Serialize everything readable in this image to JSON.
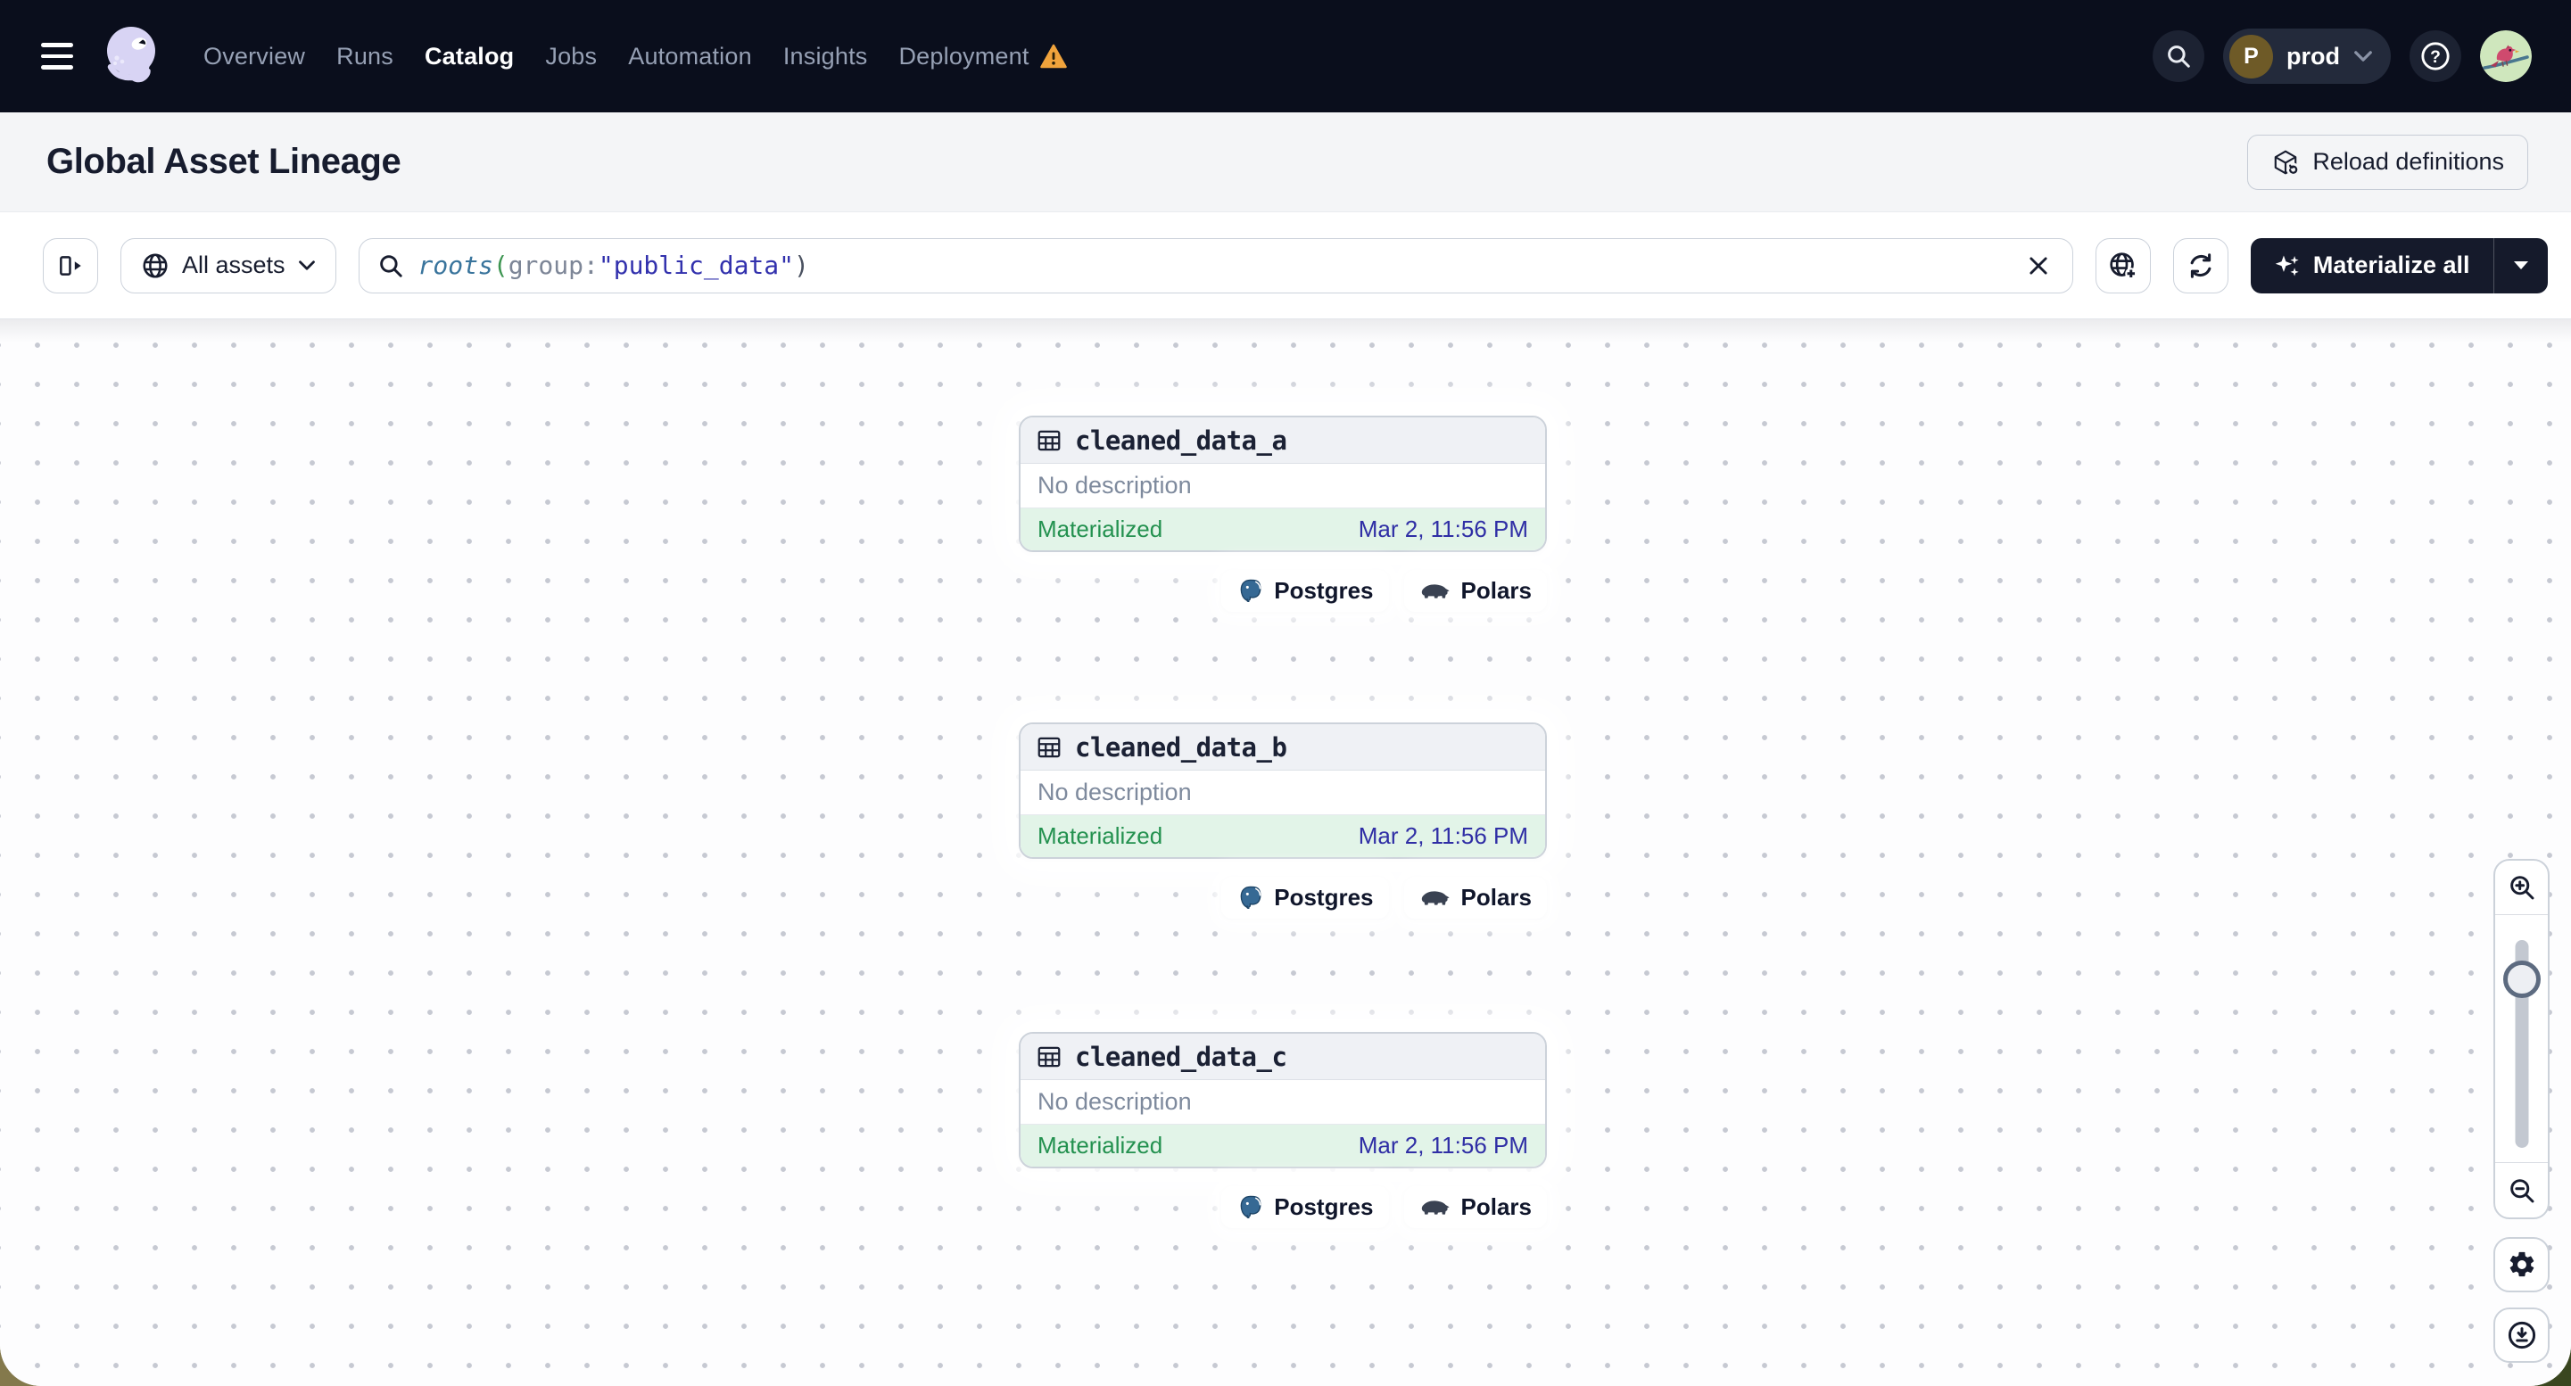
{
  "navbar": {
    "links": [
      {
        "label": "Overview",
        "active": false
      },
      {
        "label": "Runs",
        "active": false
      },
      {
        "label": "Catalog",
        "active": true
      },
      {
        "label": "Jobs",
        "active": false
      },
      {
        "label": "Automation",
        "active": false
      },
      {
        "label": "Insights",
        "active": false
      },
      {
        "label": "Deployment",
        "active": false,
        "warning": true
      }
    ],
    "environment": {
      "initial": "P",
      "name": "prod"
    },
    "icons": {
      "menu": "hamburger-menu-icon",
      "logo": "dagster-logo",
      "deployment_warning": "warning-triangle-icon",
      "search": "search-icon",
      "help": "help-icon",
      "avatar": "user-avatar"
    }
  },
  "page_header": {
    "title": "Global Asset Lineage",
    "reload_button_label": "Reload definitions",
    "reload_icon": "reload-code-location-icon"
  },
  "toolbar": {
    "panel_icon": "expand-panel-icon",
    "asset_filter_label": "All assets",
    "asset_filter_icon": "globe-icon",
    "query": {
      "full": "roots(group:\"public_data\")",
      "tokens": [
        {
          "text": "roots",
          "type": "function"
        },
        {
          "text": "(",
          "type": "paren-open"
        },
        {
          "text": "group",
          "type": "attribute"
        },
        {
          "text": ":",
          "type": "colon"
        },
        {
          "text": "\"public_data\"",
          "type": "string"
        },
        {
          "text": ")",
          "type": "paren-close"
        }
      ]
    },
    "clear_icon": "clear-x-icon",
    "graph_filter_icon": "globe-add-icon",
    "refresh_icon": "refresh-icon",
    "materialize_button_label": "Materialize all",
    "materialize_icon": "sparkles-icon"
  },
  "lineage": {
    "nodes": [
      {
        "name": "cleaned_data_a",
        "description": "No description",
        "status": "Materialized",
        "materialized_at": "Mar 2, 11:56 PM",
        "icon": "table-icon",
        "tags": [
          {
            "label": "Postgres",
            "icon": "postgres-icon"
          },
          {
            "label": "Polars",
            "icon": "polars-icon"
          }
        ]
      },
      {
        "name": "cleaned_data_b",
        "description": "No description",
        "status": "Materialized",
        "materialized_at": "Mar 2, 11:56 PM",
        "icon": "table-icon",
        "tags": [
          {
            "label": "Postgres",
            "icon": "postgres-icon"
          },
          {
            "label": "Polars",
            "icon": "polars-icon"
          }
        ]
      },
      {
        "name": "cleaned_data_c",
        "description": "No description",
        "status": "Materialized",
        "materialized_at": "Mar 2, 11:56 PM",
        "icon": "table-icon",
        "tags": [
          {
            "label": "Postgres",
            "icon": "postgres-icon"
          },
          {
            "label": "Polars",
            "icon": "polars-icon"
          }
        ]
      }
    ],
    "controls": {
      "zoom_in_icon": "zoom-in-icon",
      "zoom_out_icon": "zoom-out-icon",
      "settings_icon": "gear-icon",
      "download_icon": "download-icon"
    }
  },
  "colors": {
    "navbar_bg": "#0a0e1c",
    "warning_orange": "#f0a33c",
    "page_band_bg": "#f4f5f7",
    "materialize_button_bg": "#151a2b",
    "status_materialized_text": "#23914f",
    "status_materialized_bg": "#e2f4e8",
    "timestamp_indigo": "#2f2ea5",
    "query_function_teal": "#39749c",
    "query_string_indigo": "#3231ad",
    "postgres_blue": "#366994",
    "logo_lavender": "#d8d4f4"
  }
}
